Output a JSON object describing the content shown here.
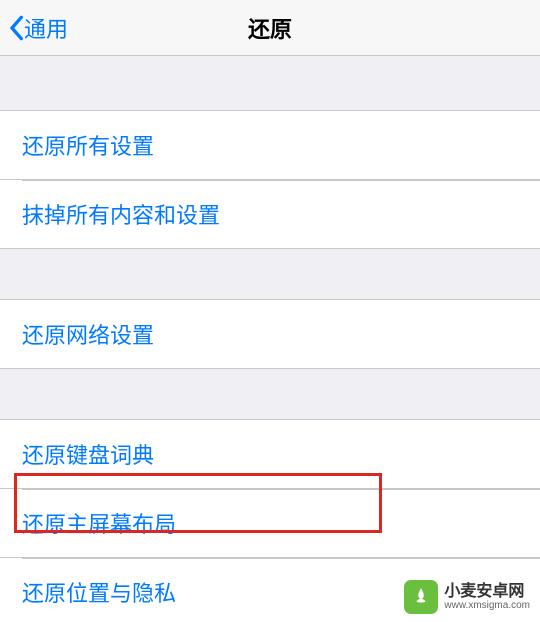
{
  "nav": {
    "back_label": "通用",
    "title": "还原"
  },
  "groups": [
    {
      "items": [
        "还原所有设置",
        "抹掉所有内容和设置"
      ]
    },
    {
      "items": [
        "还原网络设置"
      ]
    },
    {
      "items": [
        "还原键盘词典",
        "还原主屏幕布局",
        "还原位置与隐私"
      ]
    }
  ],
  "highlighted_item": "还原主屏幕布局",
  "watermark": {
    "name": "小麦安卓网",
    "url": "www.xmsigma.com"
  }
}
